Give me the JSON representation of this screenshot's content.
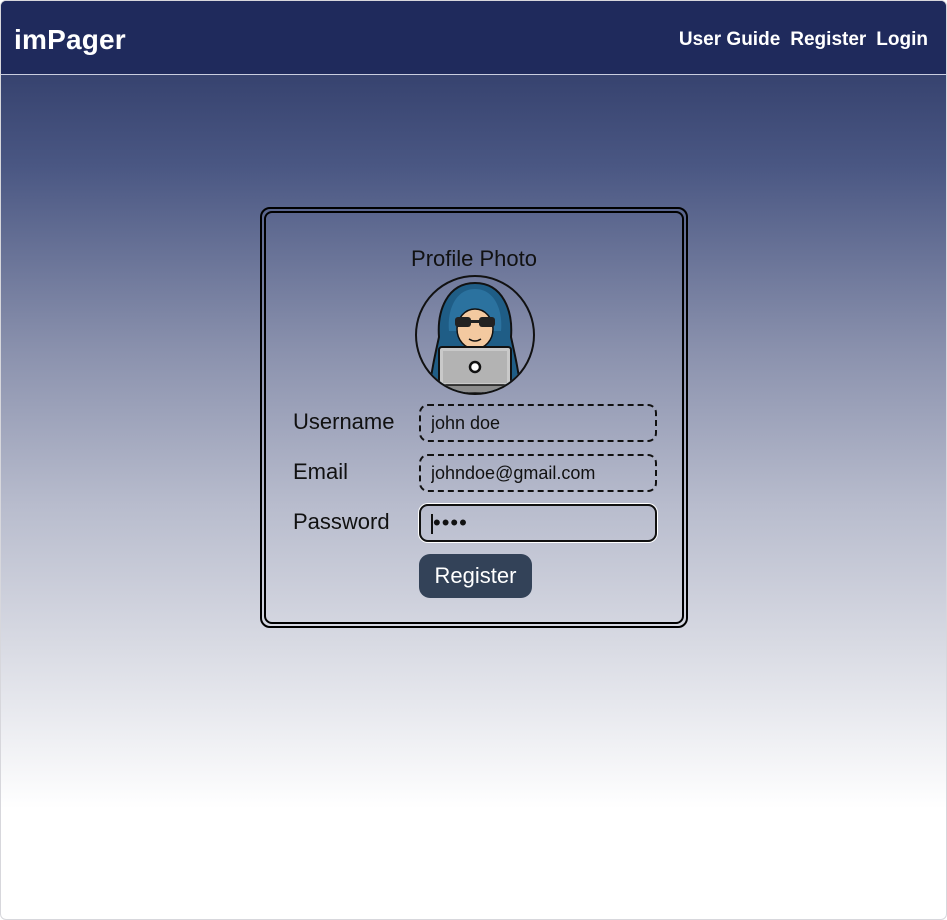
{
  "navbar": {
    "brand": "imPager",
    "links": [
      "User Guide",
      "Register",
      "Login"
    ]
  },
  "form": {
    "photo_title": "Profile Photo",
    "avatar_icon": "hacker-avatar-icon",
    "username_label": "Username",
    "username_value": "john doe",
    "email_label": "Email",
    "email_value": "johndoe@gmail.com",
    "password_label": "Password",
    "password_mask": "••••",
    "submit_label": "Register"
  },
  "colors": {
    "navbar_bg": "#1f2a5c",
    "button_bg": "#334258"
  }
}
